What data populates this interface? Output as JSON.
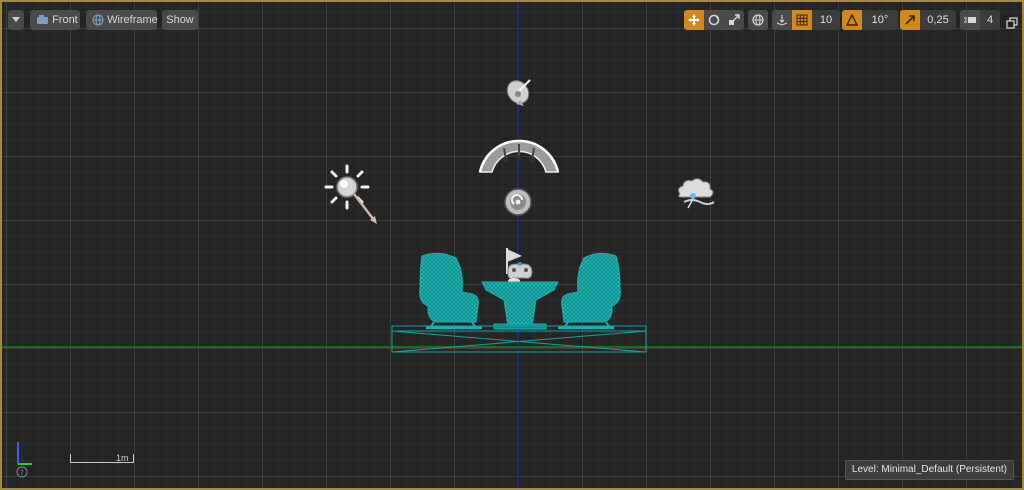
{
  "toolbar": {
    "viewport_options_icon": "chevron-down-icon",
    "view_mode_label": "Front",
    "view_mode_icon": "camera-icon",
    "render_mode_label": "Wireframe",
    "render_mode_icon": "wireframe-sphere-icon",
    "show_label": "Show",
    "grid_snap_value": "10",
    "rotation_snap_value": "10°",
    "scale_snap_value": "0,25",
    "camera_speed_value": "4"
  },
  "status": {
    "level_prefix": "Level:",
    "level_name": "Minimal_Default (Persistent)"
  },
  "scale_bar": {
    "label": "1m"
  },
  "colors": {
    "accent": "#d18a19",
    "frame": "#a58a3a",
    "wireframe": "#1aa0a0",
    "x_axis": "#1e6a1e",
    "z_axis": "#1f2a78"
  }
}
